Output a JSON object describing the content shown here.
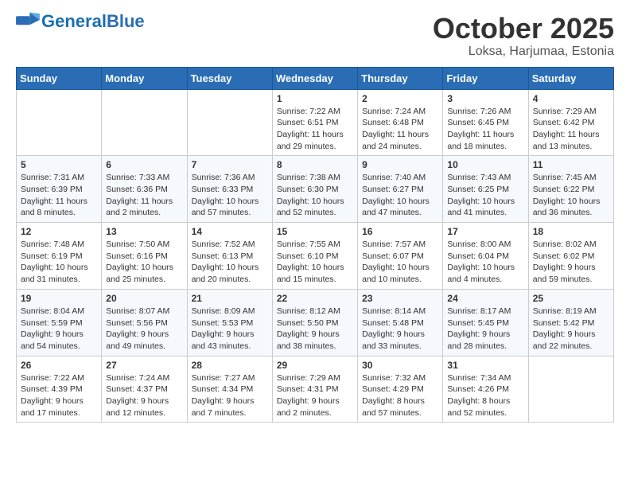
{
  "header": {
    "logo_general": "General",
    "logo_blue": "Blue",
    "month_title": "October 2025",
    "location": "Loksa, Harjumaa, Estonia"
  },
  "days_of_week": [
    "Sunday",
    "Monday",
    "Tuesday",
    "Wednesday",
    "Thursday",
    "Friday",
    "Saturday"
  ],
  "weeks": [
    [
      {
        "day": "",
        "info": ""
      },
      {
        "day": "",
        "info": ""
      },
      {
        "day": "",
        "info": ""
      },
      {
        "day": "1",
        "info": "Sunrise: 7:22 AM\nSunset: 6:51 PM\nDaylight: 11 hours\nand 29 minutes."
      },
      {
        "day": "2",
        "info": "Sunrise: 7:24 AM\nSunset: 6:48 PM\nDaylight: 11 hours\nand 24 minutes."
      },
      {
        "day": "3",
        "info": "Sunrise: 7:26 AM\nSunset: 6:45 PM\nDaylight: 11 hours\nand 18 minutes."
      },
      {
        "day": "4",
        "info": "Sunrise: 7:29 AM\nSunset: 6:42 PM\nDaylight: 11 hours\nand 13 minutes."
      }
    ],
    [
      {
        "day": "5",
        "info": "Sunrise: 7:31 AM\nSunset: 6:39 PM\nDaylight: 11 hours\nand 8 minutes."
      },
      {
        "day": "6",
        "info": "Sunrise: 7:33 AM\nSunset: 6:36 PM\nDaylight: 11 hours\nand 2 minutes."
      },
      {
        "day": "7",
        "info": "Sunrise: 7:36 AM\nSunset: 6:33 PM\nDaylight: 10 hours\nand 57 minutes."
      },
      {
        "day": "8",
        "info": "Sunrise: 7:38 AM\nSunset: 6:30 PM\nDaylight: 10 hours\nand 52 minutes."
      },
      {
        "day": "9",
        "info": "Sunrise: 7:40 AM\nSunset: 6:27 PM\nDaylight: 10 hours\nand 47 minutes."
      },
      {
        "day": "10",
        "info": "Sunrise: 7:43 AM\nSunset: 6:25 PM\nDaylight: 10 hours\nand 41 minutes."
      },
      {
        "day": "11",
        "info": "Sunrise: 7:45 AM\nSunset: 6:22 PM\nDaylight: 10 hours\nand 36 minutes."
      }
    ],
    [
      {
        "day": "12",
        "info": "Sunrise: 7:48 AM\nSunset: 6:19 PM\nDaylight: 10 hours\nand 31 minutes."
      },
      {
        "day": "13",
        "info": "Sunrise: 7:50 AM\nSunset: 6:16 PM\nDaylight: 10 hours\nand 25 minutes."
      },
      {
        "day": "14",
        "info": "Sunrise: 7:52 AM\nSunset: 6:13 PM\nDaylight: 10 hours\nand 20 minutes."
      },
      {
        "day": "15",
        "info": "Sunrise: 7:55 AM\nSunset: 6:10 PM\nDaylight: 10 hours\nand 15 minutes."
      },
      {
        "day": "16",
        "info": "Sunrise: 7:57 AM\nSunset: 6:07 PM\nDaylight: 10 hours\nand 10 minutes."
      },
      {
        "day": "17",
        "info": "Sunrise: 8:00 AM\nSunset: 6:04 PM\nDaylight: 10 hours\nand 4 minutes."
      },
      {
        "day": "18",
        "info": "Sunrise: 8:02 AM\nSunset: 6:02 PM\nDaylight: 9 hours\nand 59 minutes."
      }
    ],
    [
      {
        "day": "19",
        "info": "Sunrise: 8:04 AM\nSunset: 5:59 PM\nDaylight: 9 hours\nand 54 minutes."
      },
      {
        "day": "20",
        "info": "Sunrise: 8:07 AM\nSunset: 5:56 PM\nDaylight: 9 hours\nand 49 minutes."
      },
      {
        "day": "21",
        "info": "Sunrise: 8:09 AM\nSunset: 5:53 PM\nDaylight: 9 hours\nand 43 minutes."
      },
      {
        "day": "22",
        "info": "Sunrise: 8:12 AM\nSunset: 5:50 PM\nDaylight: 9 hours\nand 38 minutes."
      },
      {
        "day": "23",
        "info": "Sunrise: 8:14 AM\nSunset: 5:48 PM\nDaylight: 9 hours\nand 33 minutes."
      },
      {
        "day": "24",
        "info": "Sunrise: 8:17 AM\nSunset: 5:45 PM\nDaylight: 9 hours\nand 28 minutes."
      },
      {
        "day": "25",
        "info": "Sunrise: 8:19 AM\nSunset: 5:42 PM\nDaylight: 9 hours\nand 22 minutes."
      }
    ],
    [
      {
        "day": "26",
        "info": "Sunrise: 7:22 AM\nSunset: 4:39 PM\nDaylight: 9 hours\nand 17 minutes."
      },
      {
        "day": "27",
        "info": "Sunrise: 7:24 AM\nSunset: 4:37 PM\nDaylight: 9 hours\nand 12 minutes."
      },
      {
        "day": "28",
        "info": "Sunrise: 7:27 AM\nSunset: 4:34 PM\nDaylight: 9 hours\nand 7 minutes."
      },
      {
        "day": "29",
        "info": "Sunrise: 7:29 AM\nSunset: 4:31 PM\nDaylight: 9 hours\nand 2 minutes."
      },
      {
        "day": "30",
        "info": "Sunrise: 7:32 AM\nSunset: 4:29 PM\nDaylight: 8 hours\nand 57 minutes."
      },
      {
        "day": "31",
        "info": "Sunrise: 7:34 AM\nSunset: 4:26 PM\nDaylight: 8 hours\nand 52 minutes."
      },
      {
        "day": "",
        "info": ""
      }
    ]
  ]
}
